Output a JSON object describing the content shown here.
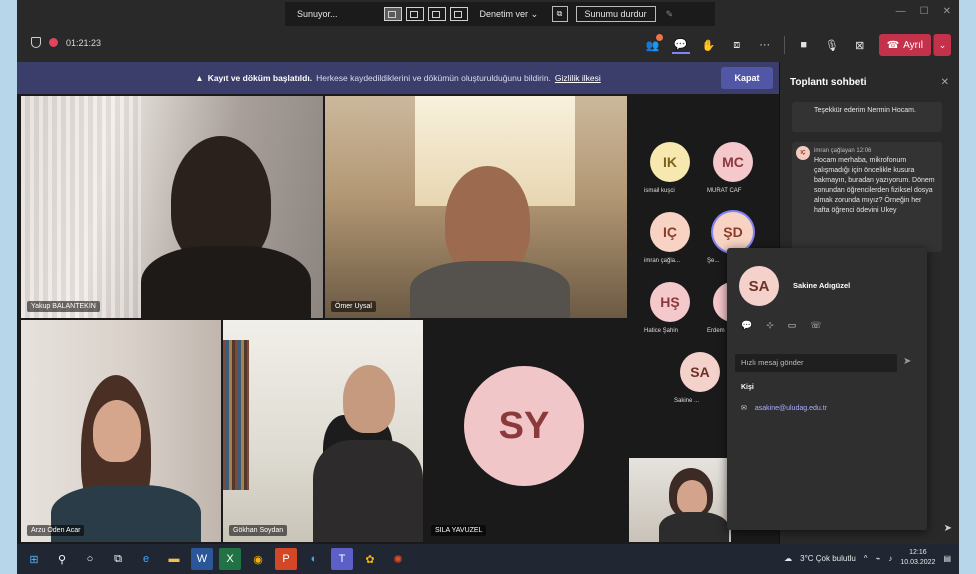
{
  "presenter_bar": {
    "status": "Sunuyor...",
    "give_control": "Denetim ver",
    "stop_presenting": "Sunumu durdur"
  },
  "meeting": {
    "elapsed": "01:21:23",
    "leave_label": "Ayrıl"
  },
  "banner": {
    "bold": "Kayıt ve döküm başlatıldı.",
    "text": "Herkese kaydedildiklerini ve dökümün oluşturulduğunu bildirin.",
    "link": "Gizlilik ilkesi",
    "close": "Kapat"
  },
  "participants": {
    "video_tiles": [
      {
        "name": "Yakup BALANTEKİN"
      },
      {
        "name": "Ömer Uysal"
      },
      {
        "name": "Arzu Öden Acar"
      },
      {
        "name": "Gökhan Soydan"
      }
    ],
    "big_avatar": {
      "initials": "SY",
      "name": "SILA YAVUZEL"
    },
    "roster": [
      {
        "initials": "IK",
        "label": "ismail kuşci",
        "color": "#f7e8b0",
        "text": "#7a6220"
      },
      {
        "initials": "MC",
        "label": "MURAT CAF",
        "color": "#f5c8cc",
        "text": "#8a3a3a"
      },
      {
        "initials": "IÇ",
        "label": "imran çağla...",
        "color": "#f8d2c2",
        "text": "#8a3d2a"
      },
      {
        "initials": "ŞD",
        "label": "Şe...",
        "color": "#f8d2c2",
        "text": "#8a3d2a"
      },
      {
        "initials": "HŞ",
        "label": "Hatice Şahin",
        "color": "#f5c8cc",
        "text": "#8a3a3a"
      },
      {
        "initials": "E",
        "label": "Erdem",
        "color": "#f5c8cc",
        "text": "#8a3a3a"
      },
      {
        "initials": "SA",
        "label": "Sakine ...",
        "color": "#f4d2cb",
        "text": "#6b3326"
      }
    ]
  },
  "chat": {
    "title": "Toplantı sohbeti",
    "messages": [
      {
        "text": "Teşekkür ederim Nermin Hocam."
      },
      {
        "author": "imran çağlayan",
        "time": "12:06",
        "initials": "IÇ",
        "text": "Hocam merhaba, mikrofonum çalışmadığı için öncelikle kusura bakmayın, buradan yazıyorum. Dönem sonundan öğrencilerden fiziksel dosya almak zorunda mıyız? Örneğin her hafta öğrenci ödevini Ukey"
      }
    ]
  },
  "profile_card": {
    "initials": "SA",
    "name": "Sakine Adıgüzel",
    "quick_message_placeholder": "Hızlı mesaj gönder",
    "contact_heading": "Kişi",
    "email": "asakine@uludag.edu.tr"
  },
  "taskbar": {
    "weather": "3°C Çok bulutlu",
    "time": "12:16",
    "date": "10.03.2022"
  }
}
